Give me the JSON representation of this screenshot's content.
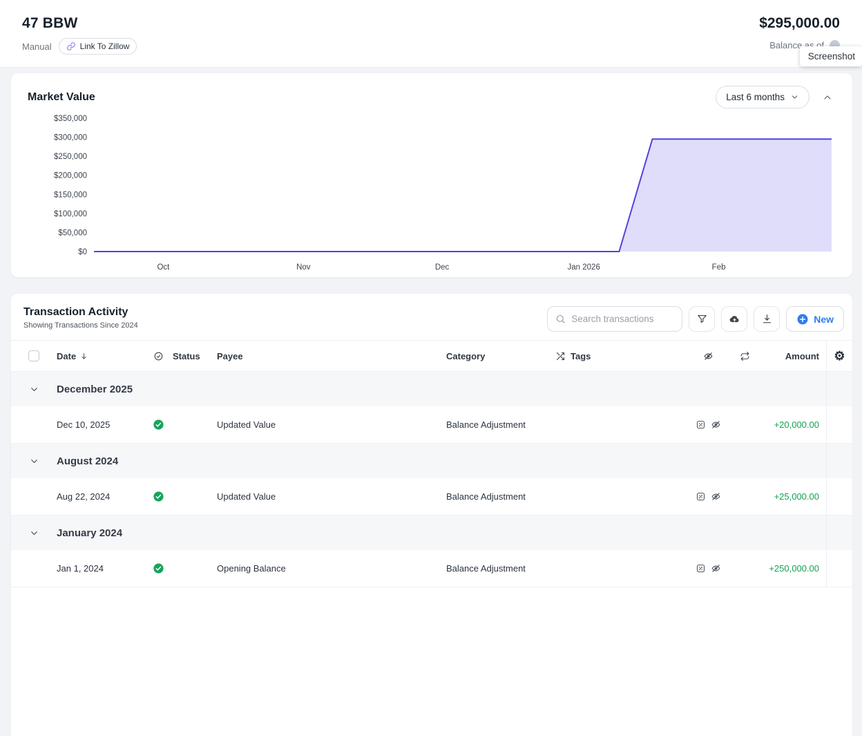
{
  "header": {
    "title": "47 BBW",
    "account_type": "Manual",
    "link_button_label": "Link To Zillow",
    "balance": "$295,000.00",
    "balance_caption": "Balance as of",
    "tooltip": "Screenshot"
  },
  "market_value": {
    "title": "Market Value",
    "range_label": "Last 6 months"
  },
  "chart_data": {
    "type": "area",
    "title": "Market Value",
    "ylim": [
      0,
      350000
    ],
    "grid": false,
    "legend": "none",
    "y_ticks": [
      {
        "value": 350000,
        "label": "$350,000"
      },
      {
        "value": 300000,
        "label": "$300,000"
      },
      {
        "value": 250000,
        "label": "$250,000"
      },
      {
        "value": 200000,
        "label": "$200,000"
      },
      {
        "value": 150000,
        "label": "$150,000"
      },
      {
        "value": 100000,
        "label": "$100,000"
      },
      {
        "value": 50000,
        "label": "$50,000"
      },
      {
        "value": 0,
        "label": "$0"
      }
    ],
    "x_ticks": [
      {
        "pos": 0.094,
        "label": "Oct"
      },
      {
        "pos": 0.284,
        "label": "Nov"
      },
      {
        "pos": 0.472,
        "label": "Dec"
      },
      {
        "pos": 0.664,
        "label": "Jan 2026"
      },
      {
        "pos": 0.847,
        "label": "Feb"
      }
    ],
    "series": [
      {
        "name": "Market Value",
        "points": [
          {
            "pos": 0,
            "value": 0
          },
          {
            "pos": 0.712,
            "value": 0
          },
          {
            "pos": 0.757,
            "value": 295000
          },
          {
            "pos": 1,
            "value": 295000
          }
        ]
      }
    ],
    "line_color": "#5241e3",
    "fill_color": "#5241e3",
    "fill_opacity": 0.18
  },
  "transactions": {
    "title": "Transaction Activity",
    "subtitle": "Showing Transactions Since 2024",
    "search_placeholder": "Search transactions",
    "new_button_label": "New",
    "columns": {
      "date": "Date",
      "status": "Status",
      "payee": "Payee",
      "category": "Category",
      "tags": "Tags",
      "amount": "Amount"
    },
    "groups": [
      {
        "label": "December 2025",
        "rows": [
          {
            "date": "Dec 10, 2025",
            "payee": "Updated Value",
            "category": "Balance Adjustment",
            "amount": "+20,000.00"
          }
        ]
      },
      {
        "label": "August 2024",
        "rows": [
          {
            "date": "Aug 22, 2024",
            "payee": "Updated Value",
            "category": "Balance Adjustment",
            "amount": "+25,000.00"
          }
        ]
      },
      {
        "label": "January 2024",
        "rows": [
          {
            "date": "Jan 1, 2024",
            "payee": "Opening Balance",
            "category": "Balance Adjustment",
            "amount": "+250,000.00"
          }
        ]
      }
    ]
  },
  "colors": {
    "accent_blue": "#2e7cf0",
    "positive_green": "#12a150",
    "chart_purple": "#5241e3"
  }
}
